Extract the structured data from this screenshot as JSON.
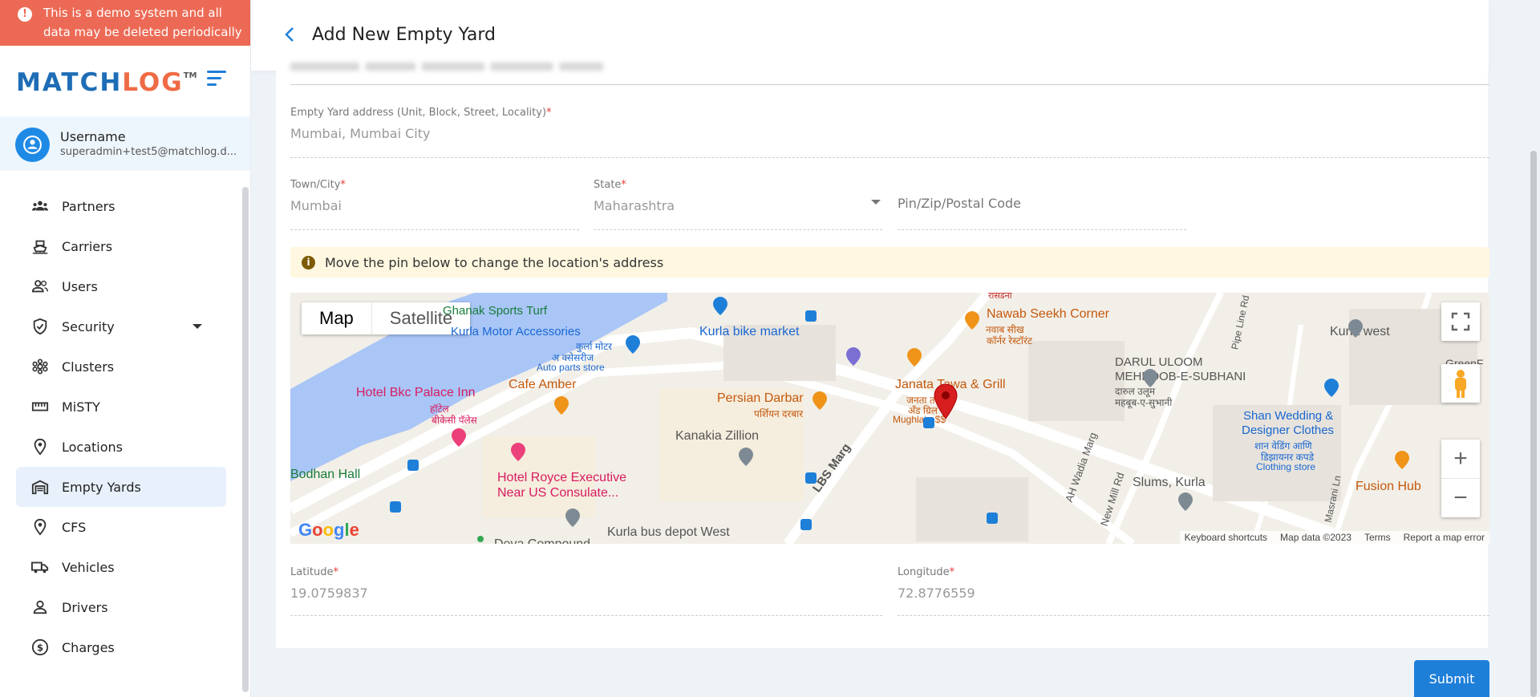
{
  "banner": {
    "text": "This is a demo system and all data may be deleted periodically"
  },
  "brand": {
    "logo_match": "MATCH",
    "logo_log": "LOG",
    "logo_tm": "TM"
  },
  "user": {
    "name": "Username",
    "email": "superadmin+test5@matchlog.d..."
  },
  "nav": [
    {
      "label": "Partners",
      "icon": "partners-icon"
    },
    {
      "label": "Carriers",
      "icon": "ship-icon"
    },
    {
      "label": "Users",
      "icon": "users-icon"
    },
    {
      "label": "Security",
      "icon": "shield-icon"
    },
    {
      "label": "Clusters",
      "icon": "clusters-icon"
    },
    {
      "label": "MiSTY",
      "icon": "ruler-icon"
    },
    {
      "label": "Locations",
      "icon": "location-pin-icon"
    },
    {
      "label": "Empty Yards",
      "icon": "warehouse-icon"
    },
    {
      "label": "CFS",
      "icon": "location-pin-icon"
    },
    {
      "label": "Vehicles",
      "icon": "truck-icon"
    },
    {
      "label": "Drivers",
      "icon": "person-icon"
    },
    {
      "label": "Charges",
      "icon": "dollar-icon"
    }
  ],
  "page": {
    "title": "Add New Empty Yard"
  },
  "form": {
    "address_label": "Empty Yard address (Unit, Block, Street, Locality)",
    "address_value": "Mumbai, Mumbai City",
    "city_label": "Town/City",
    "city_value": "Mumbai",
    "state_label": "State",
    "state_value": "Maharashtra",
    "pin_placeholder": "Pin/Zip/Postal Code",
    "info_text": "Move the pin below to change the location's address",
    "latitude_label": "Latitude",
    "latitude_value": "19.0759837",
    "longitude_label": "Longitude",
    "longitude_value": "72.8776559",
    "required_mark": "*",
    "submit_label": "Submit"
  },
  "map": {
    "type_map": "Map",
    "type_satellite": "Satellite",
    "logo": "Google",
    "attribution": [
      "Keyboard shortcuts",
      "Map data ©2023",
      "Terms",
      "Report a map error"
    ],
    "labels": [
      "Ghanak Sports Turf",
      "Kurla Motor Accessories",
      "कुर्ला मोटर",
      "अ क्सेसरीज",
      "Auto parts store",
      "Kurla bike market",
      "Nawab Seekh Corner",
      "नवाब सीख",
      "कॉर्नर रेस्टॉरंट",
      "Hotel Bkc Palace Inn",
      "हॉटेल",
      "बीकेसी पॅलेस",
      "Cafe Amber",
      "Persian Darbar",
      "पर्शियन दरबार",
      "Janata Tawa & Grill",
      "जनता तवा",
      "अँड ग्रिल",
      "Mughlai · $$",
      "DARUL ULOOM",
      "MEHBOOB-E-SUBHANI",
      "दारुल उलूम",
      "महबूब-ए-सुभानी",
      "Kurla west",
      "Shan Wedding &",
      "Designer Clothes",
      "शान वेडिंग आणि",
      "डिझायनर कपडे",
      "Clothing store",
      "Kanakia Zillion",
      "Bodhan Hall",
      "Hotel Royce Executive",
      "Near US Consulate...",
      "LBS Marg",
      "AH Wadia Marg",
      "New Mill Rd",
      "Slums, Kurla",
      "Fusion Hub",
      "Kurla bus depot West",
      "Pipe Line Rd",
      "Masrani Ln",
      "रासडनी",
      "Deva Compound",
      "GreenF"
    ]
  },
  "colors": {
    "banner": "#ec6a55",
    "accent": "#1e7fd9",
    "logo_blue": "#1e6db6",
    "logo_orange": "#ef6b45",
    "info_bg": "#fff7e0"
  }
}
